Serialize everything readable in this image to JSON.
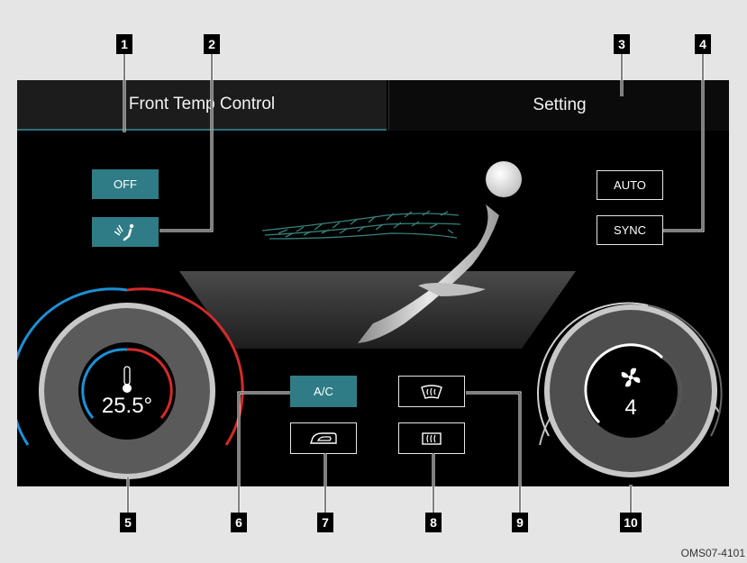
{
  "tabs": {
    "front": "Front Temp Control",
    "setting": "Setting"
  },
  "buttons": {
    "off": "OFF",
    "auto": "AUTO",
    "sync": "SYNC",
    "ac": "A/C"
  },
  "temperature": {
    "value": "25.5°"
  },
  "fan": {
    "speed": "4"
  },
  "callouts": [
    "1",
    "2",
    "3",
    "4",
    "5",
    "6",
    "7",
    "8",
    "9",
    "10"
  ],
  "credit": "OMS07-4101",
  "icons": {
    "driver_vent": "driver-seat-vent-icon",
    "recirculation": "air-recirculation-icon",
    "front_defrost": "front-defrost-icon",
    "rear_defrost": "rear-defrost-icon",
    "thermometer": "thermometer-icon",
    "fan": "fan-icon"
  },
  "colors": {
    "accent_teal": "#2f7c86",
    "cold_blue": "#1e90d6",
    "hot_red": "#d32a2a"
  }
}
